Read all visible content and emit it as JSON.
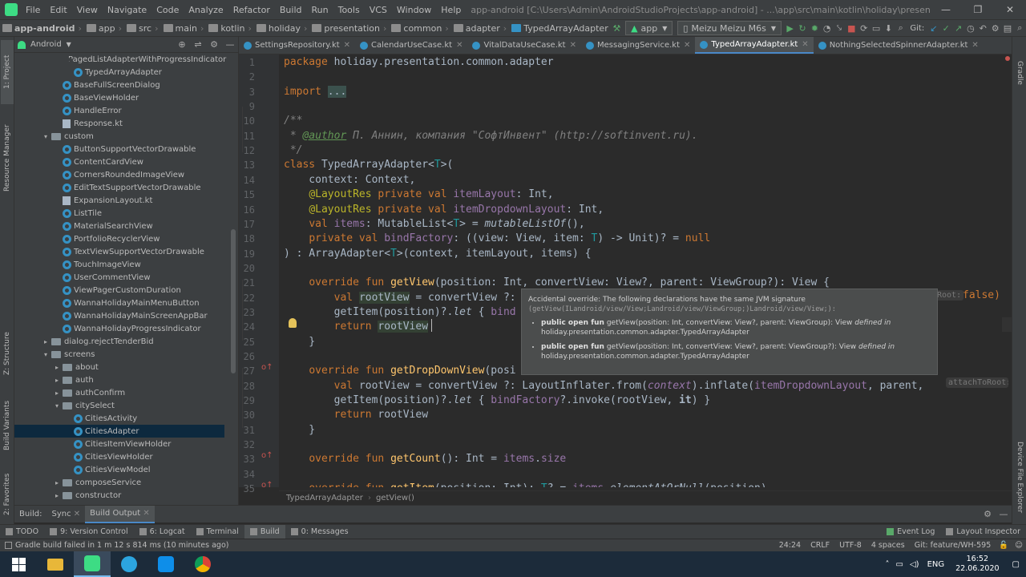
{
  "titlebar": {
    "menu": [
      "File",
      "Edit",
      "View",
      "Navigate",
      "Code",
      "Analyze",
      "Refactor",
      "Build",
      "Run",
      "Tools",
      "VCS",
      "Window",
      "Help"
    ],
    "title": "app-android [C:\\Users\\Admin\\AndroidStudioProjects\\app-android] - ...\\app\\src\\main\\kotlin\\holiday\\presentation\\common\\adapter\\TypedArrayAdapter.kt [app]"
  },
  "navbar": {
    "crumbs": [
      "app-android",
      "app",
      "src",
      "main",
      "kotlin",
      "holiday",
      "presentation",
      "common",
      "adapter",
      "TypedArrayAdapter"
    ],
    "run_config": "app",
    "device": "Meizu Meizu M6s",
    "git_label": "Git:"
  },
  "left_stripe": {
    "project": "1: Project",
    "resource_manager": "Resource Manager",
    "structure": "Z: Structure",
    "build_variants": "Build Variants",
    "favorites": "2: Favorites"
  },
  "right_stripe": {
    "gradle": "Gradle",
    "device_explorer": "Device File Explorer"
  },
  "project_panel": {
    "view_mode": "Android",
    "items": [
      {
        "label": "PagedListAdapterWithProgressIndicator",
        "kind": "class",
        "indent": 4,
        "arrow": ""
      },
      {
        "label": "TypedArrayAdapter",
        "kind": "class",
        "indent": 4,
        "arrow": ""
      },
      {
        "label": "BaseFullScreenDialog",
        "kind": "class",
        "indent": 3,
        "arrow": ""
      },
      {
        "label": "BaseViewHolder",
        "kind": "class",
        "indent": 3,
        "arrow": ""
      },
      {
        "label": "HandleError",
        "kind": "class",
        "indent": 3,
        "arrow": ""
      },
      {
        "label": "Response.kt",
        "kind": "kfile",
        "indent": 3,
        "arrow": ""
      },
      {
        "label": "custom",
        "kind": "folder",
        "indent": 2,
        "arrow": "▾"
      },
      {
        "label": "ButtonSupportVectorDrawable",
        "kind": "class",
        "indent": 3,
        "arrow": ""
      },
      {
        "label": "ContentCardView",
        "kind": "class",
        "indent": 3,
        "arrow": ""
      },
      {
        "label": "CornersRoundedImageView",
        "kind": "class",
        "indent": 3,
        "arrow": ""
      },
      {
        "label": "EditTextSupportVectorDrawable",
        "kind": "class",
        "indent": 3,
        "arrow": ""
      },
      {
        "label": "ExpansionLayout.kt",
        "kind": "kfile",
        "indent": 3,
        "arrow": ""
      },
      {
        "label": "ListTile",
        "kind": "class",
        "indent": 3,
        "arrow": ""
      },
      {
        "label": "MaterialSearchView",
        "kind": "class",
        "indent": 3,
        "arrow": ""
      },
      {
        "label": "PortfolioRecyclerView",
        "kind": "class",
        "indent": 3,
        "arrow": ""
      },
      {
        "label": "TextViewSupportVectorDrawable",
        "kind": "class",
        "indent": 3,
        "arrow": ""
      },
      {
        "label": "TouchImageView",
        "kind": "class",
        "indent": 3,
        "arrow": ""
      },
      {
        "label": "UserCommentView",
        "kind": "class",
        "indent": 3,
        "arrow": ""
      },
      {
        "label": "ViewPagerCustomDuration",
        "kind": "class",
        "indent": 3,
        "arrow": ""
      },
      {
        "label": "WannaHolidayMainMenuButton",
        "kind": "class",
        "indent": 3,
        "arrow": ""
      },
      {
        "label": "WannaHolidayMainScreenAppBar",
        "kind": "class",
        "indent": 3,
        "arrow": ""
      },
      {
        "label": "WannaHolidayProgressIndicator",
        "kind": "class",
        "indent": 3,
        "arrow": ""
      },
      {
        "label": "dialog.rejectTenderBid",
        "kind": "folder",
        "indent": 2,
        "arrow": "▸"
      },
      {
        "label": "screens",
        "kind": "folder",
        "indent": 2,
        "arrow": "▾"
      },
      {
        "label": "about",
        "kind": "folder",
        "indent": 3,
        "arrow": "▸"
      },
      {
        "label": "auth",
        "kind": "folder",
        "indent": 3,
        "arrow": "▸"
      },
      {
        "label": "authConfirm",
        "kind": "folder",
        "indent": 3,
        "arrow": "▸"
      },
      {
        "label": "citySelect",
        "kind": "folder",
        "indent": 3,
        "arrow": "▾"
      },
      {
        "label": "CitiesActivity",
        "kind": "class",
        "indent": 4,
        "arrow": ""
      },
      {
        "label": "CitiesAdapter",
        "kind": "class",
        "indent": 4,
        "arrow": "",
        "selected": true
      },
      {
        "label": "CitiesItemViewHolder",
        "kind": "class",
        "indent": 4,
        "arrow": ""
      },
      {
        "label": "CitiesViewHolder",
        "kind": "class",
        "indent": 4,
        "arrow": ""
      },
      {
        "label": "CitiesViewModel",
        "kind": "class",
        "indent": 4,
        "arrow": ""
      },
      {
        "label": "composeService",
        "kind": "folder",
        "indent": 3,
        "arrow": "▸"
      },
      {
        "label": "constructor",
        "kind": "folder",
        "indent": 3,
        "arrow": "▸"
      }
    ]
  },
  "tabs": [
    {
      "label": "SettingsRepository.kt",
      "active": false
    },
    {
      "label": "CalendarUseCase.kt",
      "active": false
    },
    {
      "label": "VitalDataUseCase.kt",
      "active": false
    },
    {
      "label": "MessagingService.kt",
      "active": false
    },
    {
      "label": "TypedArrayAdapter.kt",
      "active": true
    },
    {
      "label": "NothingSelectedSpinnerAdapter.kt",
      "active": false
    }
  ],
  "editor": {
    "line_numbers": [
      1,
      2,
      3,
      9,
      10,
      11,
      12,
      13,
      14,
      15,
      16,
      17,
      18,
      19,
      20,
      21,
      22,
      23,
      24,
      25,
      26,
      27,
      28,
      29,
      30,
      31,
      32,
      33,
      34,
      35
    ],
    "lines": [
      "<span class=\"kw\">package</span> holiday.presentation.common.adapter",
      "",
      "<span class=\"kw\">import</span> <span class=\"hl\" style=\"background:#3b514d\">...</span>",
      "",
      "<span class=\"cm\">/**</span>",
      "<span class=\"cm\"> * <u style=\"color:#629755\">@author</u> П. Аннин, компания \"СофтИнвент\" (http://softinvent.ru).</span>",
      "<span class=\"cm\"> */</span>",
      "<span class=\"kw\">class</span> TypedArrayAdapter&lt;<span class=\"tp\">T</span>&gt;(",
      "    context: Context,",
      "    <span class=\"an\">@LayoutRes</span> <span class=\"kw\">private val</span> <span class=\"pr\">itemLayout</span>: Int,",
      "    <span class=\"an\">@LayoutRes</span> <span class=\"kw\">private val</span> <span class=\"pr\">itemDropdownLayout</span>: Int,",
      "    <span class=\"kw\">val</span> <span class=\"pr\">items</span>: MutableList&lt;<span class=\"tp\">T</span>&gt; = <span class=\"it\">mutableListOf</span>(),",
      "    <span class=\"kw\">private val</span> <span class=\"pr\">bindFactory</span>: ((view: View, item: <span class=\"tp\">T</span>) -&gt; Unit)? = <span class=\"kw\">null</span>",
      ") : ArrayAdapter&lt;<span class=\"tp\">T</span>&gt;(context, itemLayout, items) {",
      "",
      "    <span class=\"kw\">override fun</span> <span class=\"fn\">getView</span>(position: Int, convertView: View?, parent: ViewGroup?): View {",
      "        <span class=\"kw\">val</span> <span class=\"hl\">rootView</span> = convertView ?:",
      "        getItem(position)?.<span class=\"it\">let</span> { <span class=\"pr\">bind</span>",
      "        <span class=\"kw\">return</span> <span class=\"hl\">rootView</span>",
      "    }",
      "",
      "    <span class=\"kw\">override fun</span> <span class=\"fn\">getDropDownView</span>(posi",
      "        <span class=\"kw\">val</span> rootView = convertView ?: LayoutInflater.from(<span class=\"pr it\">context</span>).inflate(<span class=\"pr\">itemDropdownLayout</span>, parent,",
      "        getItem(position)?.<span class=\"it\">let</span> { <span class=\"pr\">bindFactory</span>?.invoke(rootView, <span class=\"kw\" style=\"font-weight:bold;color:#a9b7c6\">it</span>) }",
      "        <span class=\"kw\">return</span> rootView",
      "    }",
      "",
      "    <span class=\"kw\">override fun</span> <span class=\"fn\">getCount</span>(): Int = <span class=\"pr\">items</span>.<span class=\"pr\">size</span>",
      "",
      "    <span class=\"kw\">override fun</span> <span class=\"fn\">getItem</span>(position: Int): <span class=\"tp\">T</span>? = <span class=\"pr\">items</span>.<span class=\"it\">elementAtOrNull</span>(position)"
    ],
    "hint_root": "Root:",
    "hint_false": "false)",
    "hint_attach": "attachToRoot:",
    "breadcrumb": [
      "TypedArrayAdapter",
      "getView()"
    ]
  },
  "tooltip": {
    "title": "Accidental override: The following declarations have the same JVM signature",
    "signature": "(getView(ILandroid/view/View;Landroid/view/ViewGroup;)Landroid/view/View;):",
    "items": [
      {
        "prefix": "public open fun",
        "sig": "getView(position: Int, convertView: View?, parent: ViewGroup): View",
        "defined": "defined in",
        "where": "holiday.presentation.common.adapter.TypedArrayAdapter"
      },
      {
        "prefix": "public open fun",
        "sig": "getView(position: Int, convertView: View?, parent: ViewGroup?): View",
        "defined": "defined in",
        "where": "holiday.presentation.common.adapter.TypedArrayAdapter"
      }
    ]
  },
  "build_panel": {
    "label": "Build:",
    "sync": "Sync",
    "output": "Build Output"
  },
  "bottom_tools": {
    "todo": "TODO",
    "version_control": "9: Version Control",
    "logcat": "6: Logcat",
    "terminal": "Terminal",
    "build": "Build",
    "messages": "0: Messages",
    "event_log": "Event Log",
    "layout_inspector": "Layout Inspector"
  },
  "status": {
    "message": "Gradle build failed in 1 m 12 s 814 ms (10 minutes ago)",
    "position": "24:24",
    "line_sep": "CRLF",
    "encoding": "UTF-8",
    "indent": "4 spaces",
    "branch": "Git: feature/WH-595"
  },
  "taskbar": {
    "time": "16:52",
    "date": "22.06.2020",
    "lang": "ENG"
  },
  "colors": {
    "accent": "#4a88c7",
    "error": "#c75450",
    "taskbar": "#1c2b3a"
  }
}
